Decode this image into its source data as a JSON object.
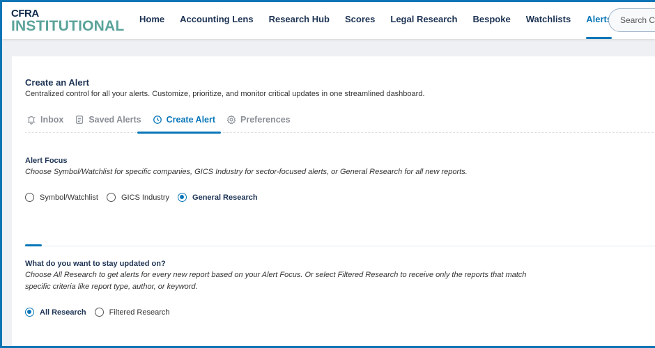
{
  "logo": {
    "line1": "CFRA",
    "line2": "INSTITUTIONAL"
  },
  "nav": [
    {
      "label": "Home"
    },
    {
      "label": "Accounting Lens"
    },
    {
      "label": "Research Hub"
    },
    {
      "label": "Scores"
    },
    {
      "label": "Legal Research"
    },
    {
      "label": "Bespoke"
    },
    {
      "label": "Watchlists"
    },
    {
      "label": "Alerts",
      "active": true
    }
  ],
  "search": {
    "placeholder": "Search CFRA"
  },
  "page": {
    "title": "Create an Alert",
    "subtitle": "Centralized control for all your alerts. Customize, prioritize, and monitor critical updates in one streamlined dashboard."
  },
  "tabs": [
    {
      "label": "Inbox",
      "icon": "bell-icon"
    },
    {
      "label": "Saved Alerts",
      "icon": "document-icon"
    },
    {
      "label": "Create Alert",
      "icon": "clock-icon",
      "active": true
    },
    {
      "label": "Preferences",
      "icon": "gear-icon"
    }
  ],
  "focus": {
    "heading": "Alert Focus",
    "description": "Choose Symbol/Watchlist for specific companies, GICS Industry for sector-focused alerts, or General Research for all new reports.",
    "options": [
      "Symbol/Watchlist",
      "GICS Industry",
      "General Research"
    ],
    "selected": "General Research"
  },
  "updates": {
    "heading": "What do you want to stay updated on?",
    "description_line1": "Choose All Research to get alerts for every new report based on your Alert Focus. Or select Filtered Research to receive only the reports that match",
    "description_line2": "specific criteria like report type, author, or keyword.",
    "options": [
      "All Research",
      "Filtered Research"
    ],
    "selected": "All Research"
  },
  "colors": {
    "accent": "#0a77b8",
    "navy": "#1d3354",
    "logo_teal": "#5aa39a"
  }
}
